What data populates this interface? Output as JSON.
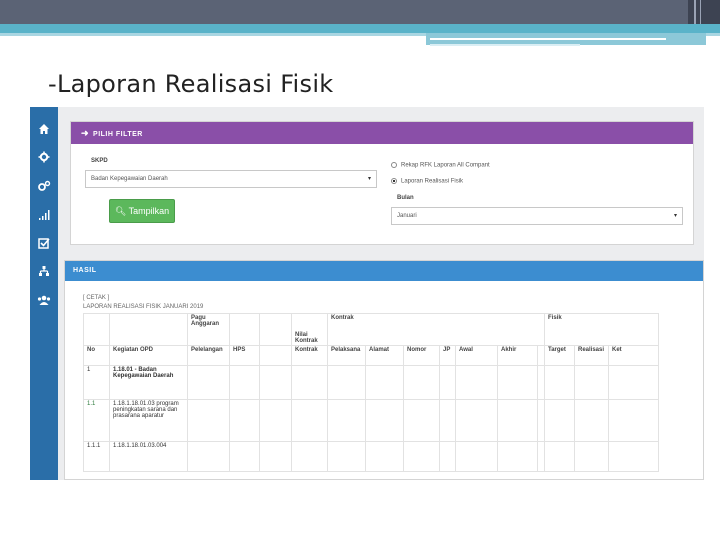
{
  "slide": {
    "title": "-Laporan Realisasi Fisik"
  },
  "sidebar": {
    "icons": [
      "home-icon",
      "gear-icon",
      "gears-icon",
      "bar-chart-icon",
      "checkbox-icon",
      "sitemap-icon",
      "users-icon"
    ]
  },
  "filter_panel": {
    "header": "PILIH FILTER",
    "skpd_label": "SKPD",
    "skpd_value": "Badan Kepegawaian Daerah",
    "button_label": "Tampilkan",
    "radio_1": "Rekap RFK Laporan All Compant",
    "radio_2": "Laporan Realisasi Fisik",
    "bulan_label": "Bulan",
    "bulan_value": "Januari"
  },
  "result_panel": {
    "header": "HASIL",
    "cetak": "[ CETAK ]",
    "report_title": "LAPORAN REALISASI FISIK JANUARI 2019",
    "columns": {
      "no": "No",
      "kegiatan": "Kegiatan OPD",
      "pagu": "Pagu Anggaran",
      "pelelangan": "Pelelangan",
      "hps": "HPS",
      "nilai": "Nilai Kontrak",
      "kontrak": "Kontrak",
      "pelaksana": "Pelaksana",
      "alamat": "Alamat",
      "nomor": "Nomor",
      "jp": "JP",
      "awal": "Awal",
      "akhir": "Akhir",
      "fisik": "Fisik",
      "target": "Target",
      "realisasi": "Realisasi",
      "ket": "Ket"
    },
    "rows": [
      {
        "no": "1",
        "kegiatan": "1.18.01 - Badan Kepegawaian Daerah"
      },
      {
        "no": "1.1",
        "kegiatan": "1.18.1.18.01.03 program peningkatan sarana dan prasarana aparatur"
      },
      {
        "no": "1.1.1",
        "kegiatan": "1.18.1.18.01.03.004"
      }
    ]
  },
  "colors": {
    "purple_header": "#8a4fa8",
    "blue_header": "#3c8dd0",
    "sidebar": "#2a6ea8",
    "green_button": "#5cb85c"
  }
}
